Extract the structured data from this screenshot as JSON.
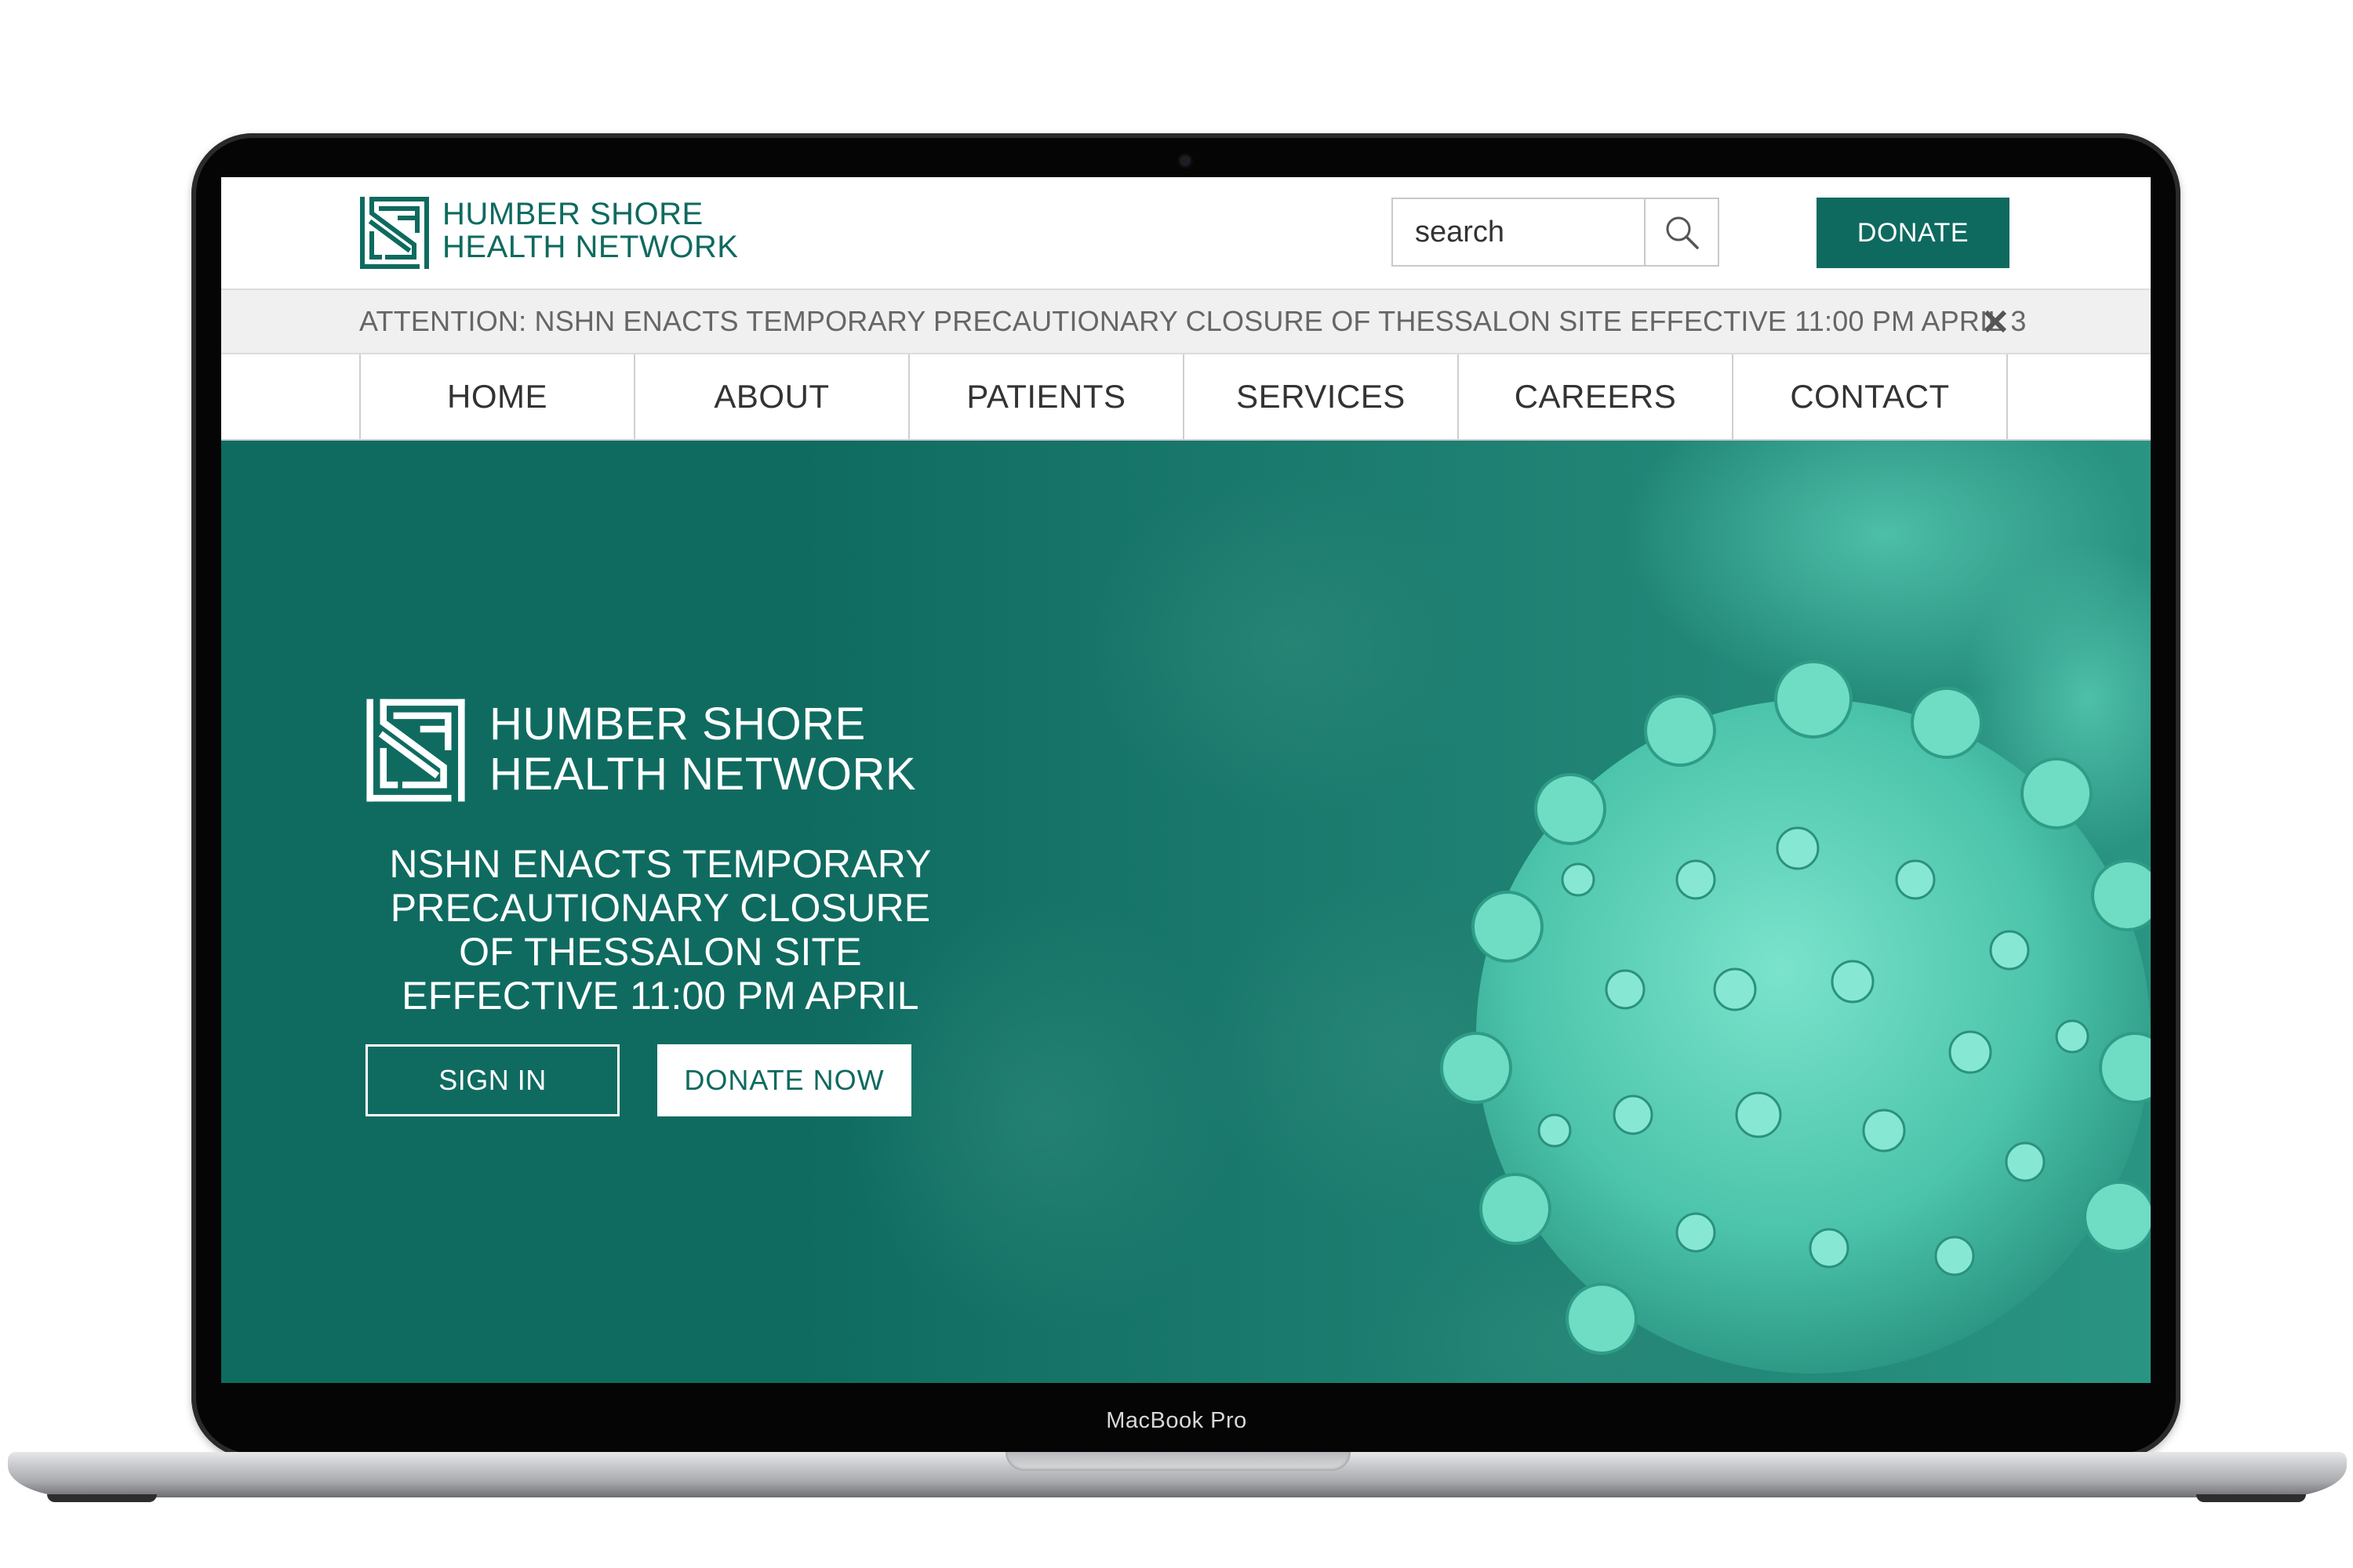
{
  "device": {
    "label": "MacBook Pro"
  },
  "header": {
    "logo_line1": "HUMBER SHORE",
    "logo_line2": "HEALTH NETWORK",
    "search_placeholder": "search",
    "donate_label": "DONATE"
  },
  "alert": {
    "text": "ATTENTION: NSHN ENACTS TEMPORARY PRECAUTIONARY CLOSURE OF THESSALON SITE EFFECTIVE 11:00 PM APRIL 3"
  },
  "nav": {
    "items": [
      {
        "label": "HOME"
      },
      {
        "label": "ABOUT"
      },
      {
        "label": "PATIENTS"
      },
      {
        "label": "SERVICES"
      },
      {
        "label": "CAREERS"
      },
      {
        "label": "CONTACT"
      }
    ]
  },
  "hero": {
    "logo_line1": "HUMBER SHORE",
    "logo_line2": "HEALTH NETWORK",
    "headline_lines": [
      "NSHN ENACTS TEMPORARY",
      "PRECAUTIONARY CLOSURE",
      "OF THESSALON SITE",
      "EFFECTIVE 11:00 PM APRIL"
    ],
    "signin_label": "SIGN IN",
    "donate_now_label": "DONATE NOW"
  },
  "colors": {
    "brand": "#0e6a5f",
    "hero_teal": "#0f6b60",
    "virus_teal": "#5fd6bd",
    "alert_bg": "#f0f0f0"
  },
  "icons": {
    "search": "search-icon",
    "close": "close-icon",
    "logo": "hsn-logo-mark",
    "virus": "virus-image"
  }
}
